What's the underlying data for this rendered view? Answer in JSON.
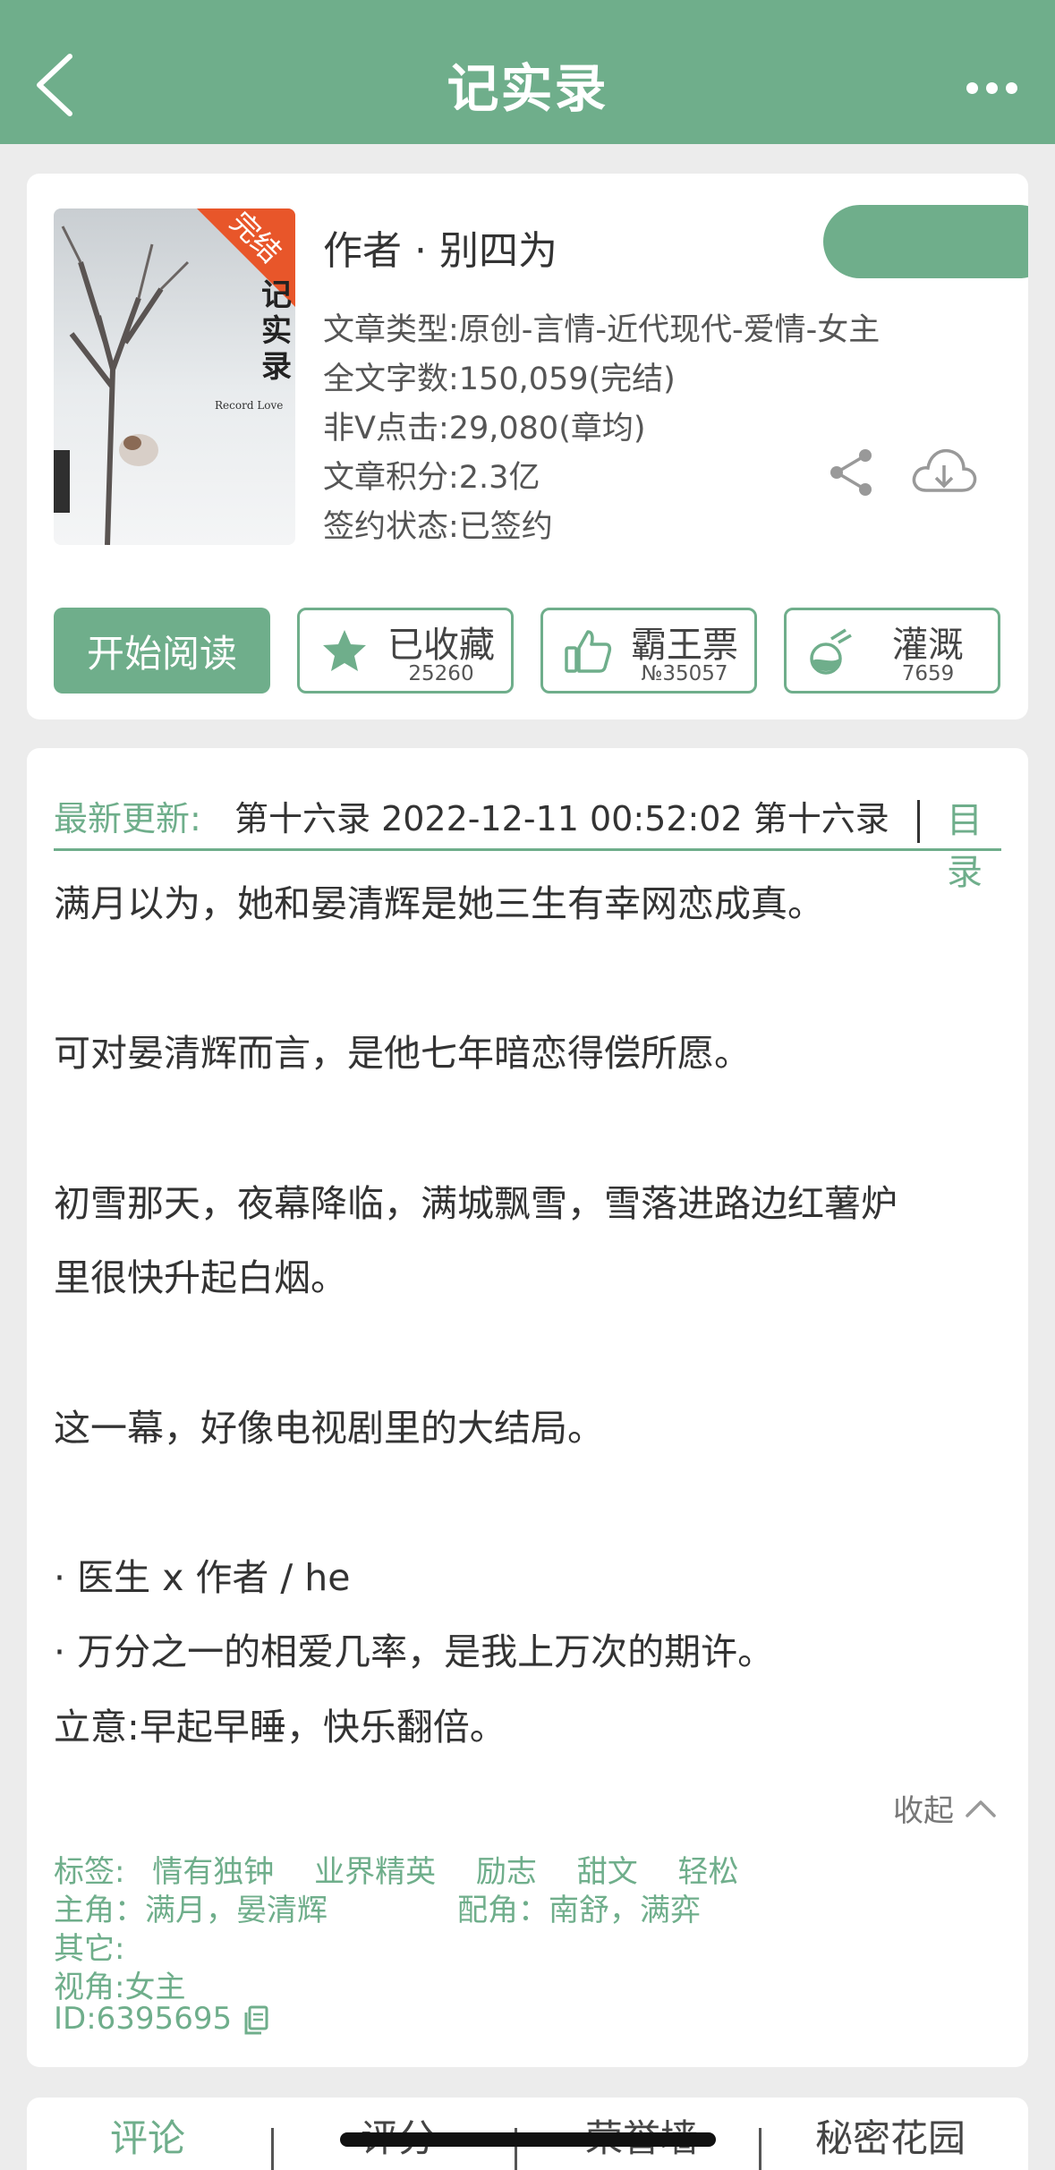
{
  "header": {
    "title": "记实录",
    "back_icon": "chevron-left-icon",
    "more_icon": "more-dots-icon"
  },
  "book": {
    "cover_title": "记实录",
    "cover_badge": "完结",
    "cover_subtitle": "Record Love",
    "author": "作者 · 别四为",
    "type": "文章类型:原创-言情-近代现代-爱情-女主",
    "word_count": "全文字数:150,059(完结)",
    "clicks": "非V点击:29,080(章均)",
    "score": "文章积分:2.3亿",
    "contract": "签约状态:已签约"
  },
  "actions": {
    "read": "开始阅读",
    "favorite": {
      "label": "已收藏",
      "count": "25260"
    },
    "vote": {
      "label": "霸王票",
      "count": "№35057"
    },
    "water": {
      "label": "灌溉",
      "count": "7659"
    }
  },
  "update": {
    "label": "最新更新:",
    "text": "第十六录 2022-12-11 00:52:02   第十六录",
    "catalog": "目录"
  },
  "synopsis": [
    "满月以为，她和晏清辉是她三生有幸网恋成真。",
    "可对晏清辉而言，是他七年暗恋得偿所愿。",
    "初雪那天，夜幕降临，满城飘雪，雪落进路边红薯炉",
    "里很快升起白烟。",
    "这一幕，好像电视剧里的大结局。",
    "· 医生 x 作者 / he",
    "· 万分之一的相爱几率，是我上万次的期许。",
    "立意:早起早睡，快乐翻倍。"
  ],
  "collapse_label": "收起",
  "meta": {
    "tags_label": "标签:",
    "tags": [
      "情有独钟",
      "业界精英",
      "励志",
      "甜文",
      "轻松"
    ],
    "protagonist": "主角：满月，晏清辉",
    "supporting": "配角：南舒，满弈",
    "other": "其它:",
    "perspective": "视角:女主",
    "id": "ID:6395695"
  },
  "tabs": [
    "评论",
    "评分",
    "荣誉墙",
    "秘密花园"
  ],
  "colors": {
    "accent": "#6fae8b",
    "background": "#ececec"
  }
}
